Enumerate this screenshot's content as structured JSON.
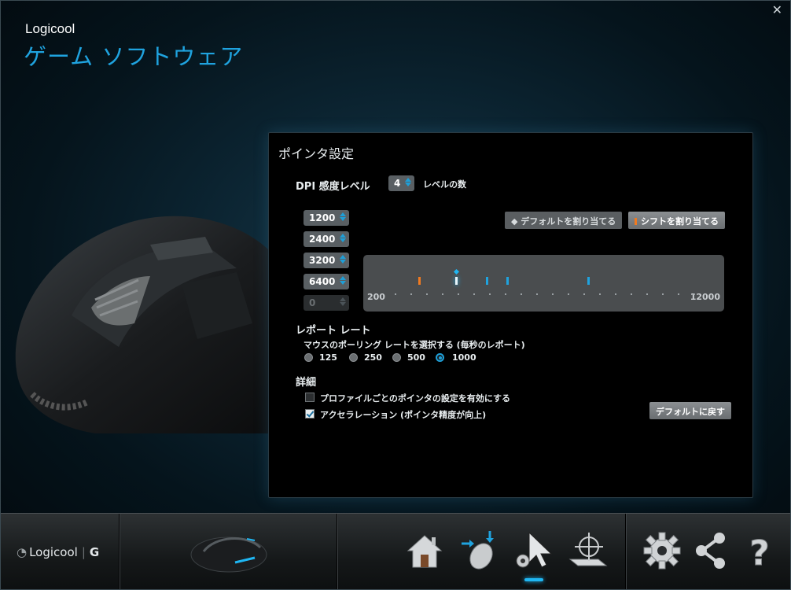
{
  "window": {
    "close_label": "✕"
  },
  "header": {
    "brand": "Logicool",
    "title": "ゲーム ソフトウェア"
  },
  "panel": {
    "title": "ポインタ設定",
    "dpi": {
      "label": "DPI 感度レベル",
      "level_count": "4",
      "level_count_label": "レベルの数",
      "levels": [
        "1200",
        "2400",
        "3200",
        "6400",
        "0"
      ],
      "assign_default_label": "◆ デフォルトを割り当てる",
      "assign_shift_label": "シフトを割り当てる",
      "slider_min": "200",
      "slider_max": "12000",
      "range": [
        200,
        12000
      ],
      "default_value": 1200,
      "shift_value": 400,
      "markers": [
        1200,
        2400,
        3200,
        6400
      ]
    },
    "report_rate": {
      "label": "レポート レート",
      "description": "マウスのポーリング レートを選択する (毎秒のレポート)",
      "options": [
        "125",
        "250",
        "500",
        "1000"
      ],
      "selected": "1000"
    },
    "advanced": {
      "label": "詳細",
      "per_profile_label": "プロファイルごとのポインタの設定を有効にする",
      "per_profile_checked": false,
      "acceleration_label": "アクセラレーション (ポインタ精度が向上)",
      "acceleration_checked": true,
      "restore_default_label": "デフォルトに戻す"
    }
  },
  "footer": {
    "logo_text": "Logicool",
    "logo_g": "G"
  },
  "colors": {
    "accent": "#1fa3df",
    "shift": "#f07a20"
  }
}
